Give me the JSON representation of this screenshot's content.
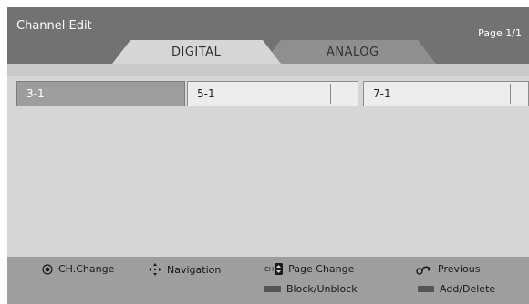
{
  "header": {
    "title": "Channel Edit",
    "page_indicator": "Page 1/1"
  },
  "tabs": [
    {
      "label": "DIGITAL",
      "active": true
    },
    {
      "label": "ANALOG",
      "active": false
    }
  ],
  "channels": [
    {
      "label": "3-1",
      "selected": true
    },
    {
      "label": "5-1",
      "selected": false
    },
    {
      "label": "7-1",
      "selected": false
    }
  ],
  "footer": {
    "ch_change": {
      "label": "CH.Change",
      "icon": "ok-button-icon"
    },
    "navigation": {
      "label": "Navigation",
      "icon": "navigation-arrows-icon"
    },
    "page_change": {
      "label": "Page Change",
      "icon": "ch-rocker-icon",
      "ch_text": "CH"
    },
    "previous": {
      "label": "Previous",
      "icon": "back-arrow-icon"
    },
    "block_unblock": {
      "label": "Block/Unblock",
      "icon": "color-key-icon"
    },
    "add_delete": {
      "label": "Add/Delete",
      "icon": "color-key-icon"
    }
  },
  "colors": {
    "header_bg": "#727272",
    "tab_active": "#d6d6d6",
    "tab_inactive": "#8f8f8f",
    "selected_cell": "#9d9d9d",
    "panel_bg": "#d6d6d6",
    "footer_bg": "#9e9e9e"
  }
}
